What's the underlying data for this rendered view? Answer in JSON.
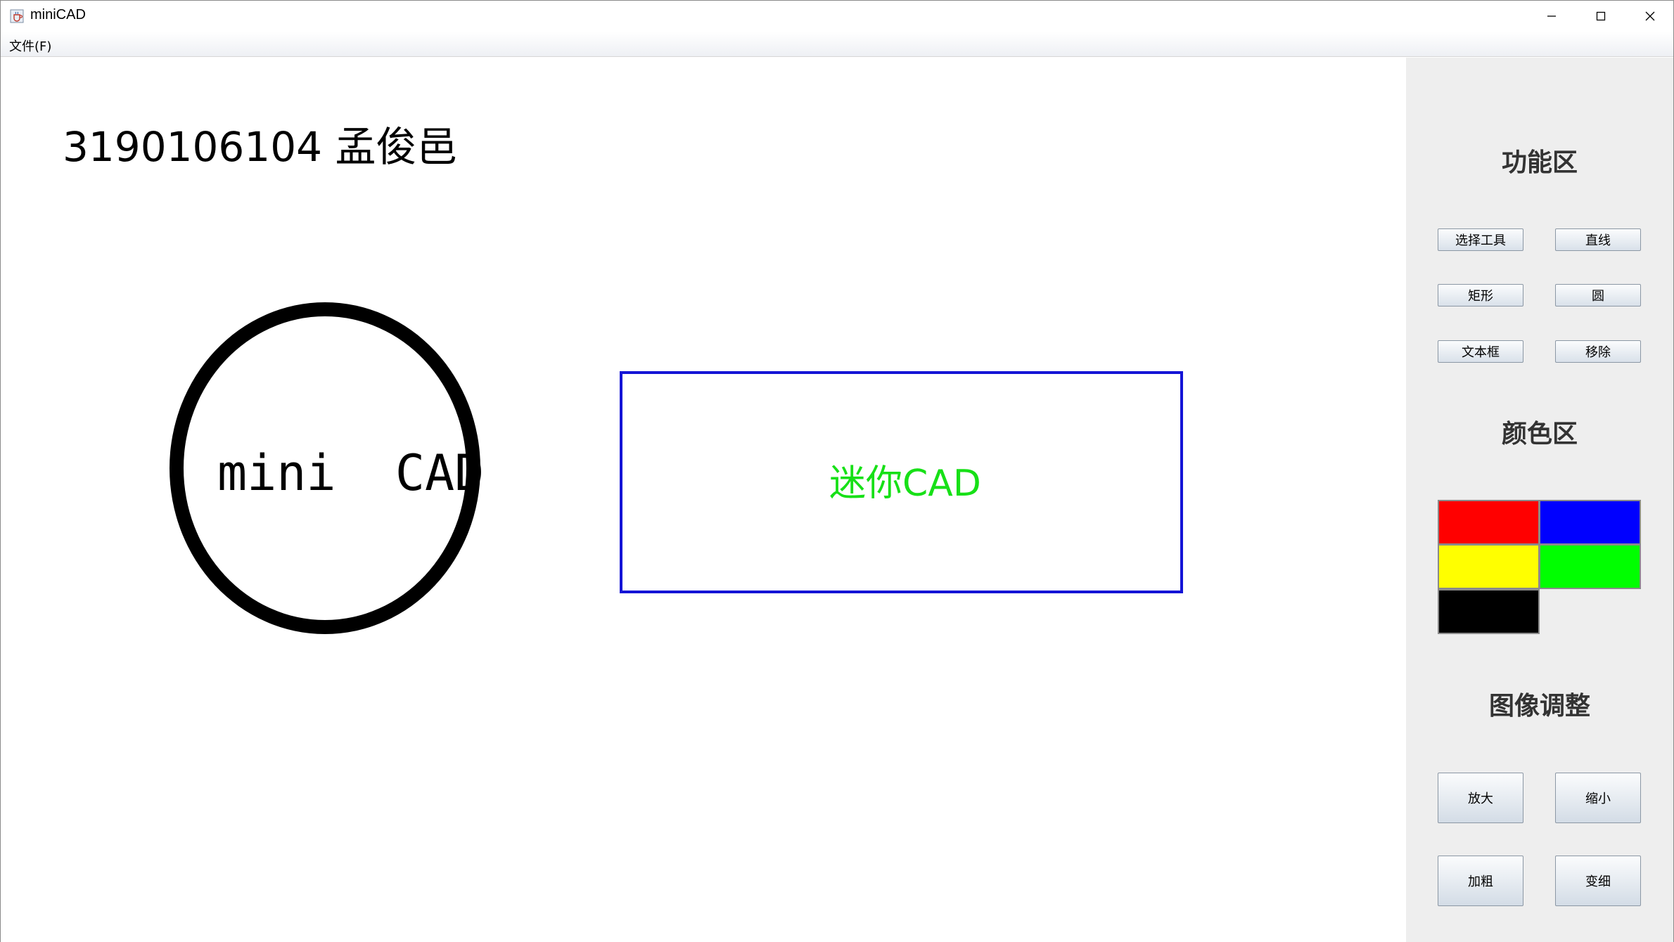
{
  "window": {
    "title": "miniCAD",
    "icon": "java-cup-icon"
  },
  "menu": {
    "file_label": "文件(F)"
  },
  "canvas": {
    "student_label": "3190106104 孟俊邑",
    "circle_text": "mini  CAD",
    "circle_color": "#000000",
    "rect_text": "迷你CAD",
    "rect_border_color": "#1414d6",
    "rect_text_color": "#17e017"
  },
  "panel": {
    "function_title": "功能区",
    "tools": {
      "select": "选择工具",
      "line": "直线",
      "rect": "矩形",
      "circle": "圆",
      "textbox": "文本框",
      "remove": "移除"
    },
    "color_title": "颜色区",
    "colors": {
      "red": "#ff0000",
      "blue": "#0000ff",
      "yellow": "#ffff00",
      "green": "#00ff00",
      "black": "#000000"
    },
    "adjust_title": "图像调整",
    "adjust": {
      "zoom_in": "放大",
      "zoom_out": "缩小",
      "thicken": "加粗",
      "thin": "变细"
    }
  }
}
